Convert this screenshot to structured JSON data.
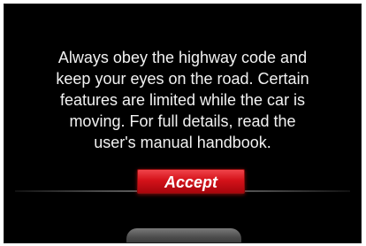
{
  "dialog": {
    "message_lines": [
      "Always obey the highway code and",
      "keep your eyes on the road. Certain",
      "features are limited while the car is",
      "moving. For full details, read the",
      "user's manual handbook."
    ],
    "accept_label": "Accept"
  },
  "colors": {
    "background": "#000000",
    "text": "#f2f2f2",
    "accept_button": "#d4121a"
  }
}
